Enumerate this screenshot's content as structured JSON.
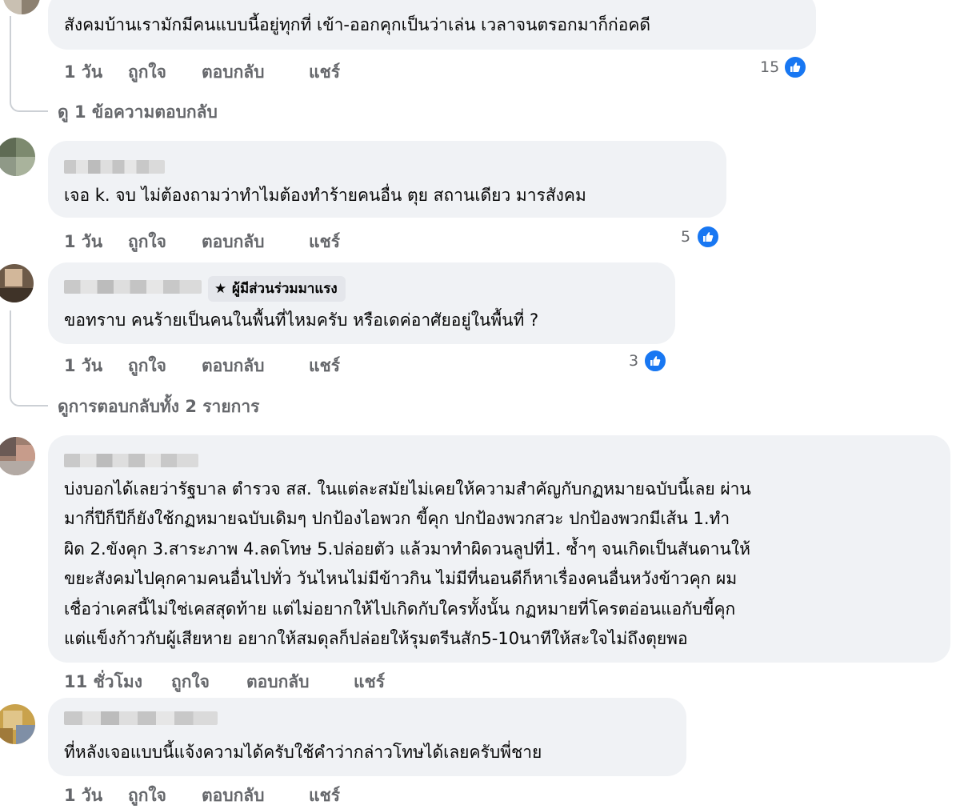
{
  "comments": [
    {
      "text_lines": [
        "สังคมบ้านเรามักมีคนแบบนี้อยู่ทุกที่ เข้า-ออกคุกเป็นว่าเล่น เวลาจนตรอกมาก็ก่อคดี"
      ],
      "time": "1 วัน",
      "reaction_count": "15"
    },
    {
      "text_lines": [
        "เจอ k. จบ ไม่ต้องถามว่าทำไมต้องทำร้ายคนอื่น ตุย สถานเดียว มารสังคม"
      ],
      "time": "1 วัน",
      "reaction_count": "5"
    },
    {
      "badge": "ผู้มีส่วนร่วมมาแรง",
      "text_lines": [
        "ขอทราบ คนร้ายเป็นคนในพื้นที่ไหมครับ หรือเดค่อาศัยอยู่ในพื้นที่ ?"
      ],
      "time": "1 วัน",
      "reaction_count": "3"
    },
    {
      "text_lines": [
        "บ่งบอกได้เลยว่ารัฐบาล ตำรวจ สส. ในแต่ละสมัยไม่เคยให้ความสำคัญกับกฏหมายฉบับนี้เลย ผ่าน",
        "มากี่ปีก็ปีก็ยังใช้กฏหมายฉบับเดิมๆ ปกป้องไอพวก ขี้คุก ปกป้องพวกสวะ ปกป้องพวกมีเส้น 1.ทำ",
        "ผิด 2.ขังคุก 3.สาระภาพ 4.ลดโทษ 5.ปล่อยตัว แล้วมาทำผิดวนลูปที่1. ซ้ำๆ จนเกิดเป็นสันดานให้",
        "ขยะสังคมไปคุกคามคนอื่นไปทั่ว วันไหนไม่มีข้าวกิน ไม่มีที่นอนดีก็หาเรื่องคนอื่นหวังข้าวคุก ผม",
        "เชื่อว่าเคสนี้ไม่ใช่เคสสุดท้าย แต่ไม่อยากให้ไปเกิดกับใครทั้งนั้น กฏหมายที่โครตอ่อนแอกับขี้คุก",
        "แต่แข็งก้าวกับผู้เสียหาย อยากให้สมดุลก็ปล่อยให้รุมตรีนสัก5-10นาทีให้สะใจไม่ถึงตุยพอ"
      ],
      "time": "11 ชั่วโมง"
    },
    {
      "text_lines": [
        "ที่หลังเจอแบบนี้แจ้งความได้ครับใช้คำว่ากล่าวโทษได้เลยครับพี่ชาย"
      ],
      "time": "1 วัน"
    }
  ],
  "actions": {
    "like": "ถูกใจ",
    "reply": "ตอบกลับ",
    "share": "แชร์"
  },
  "view_replies": {
    "one": "ดู 1 ข้อความตอบกลับ",
    "all": "ดูการตอบกลับทั้ง 2 รายการ"
  },
  "colors": {
    "bubble": "#f0f2f5",
    "like_blue": "#1877f2",
    "meta_gray": "#65676b"
  },
  "icons": {
    "like": "thumbs-up-icon",
    "badge": "star-icon"
  }
}
